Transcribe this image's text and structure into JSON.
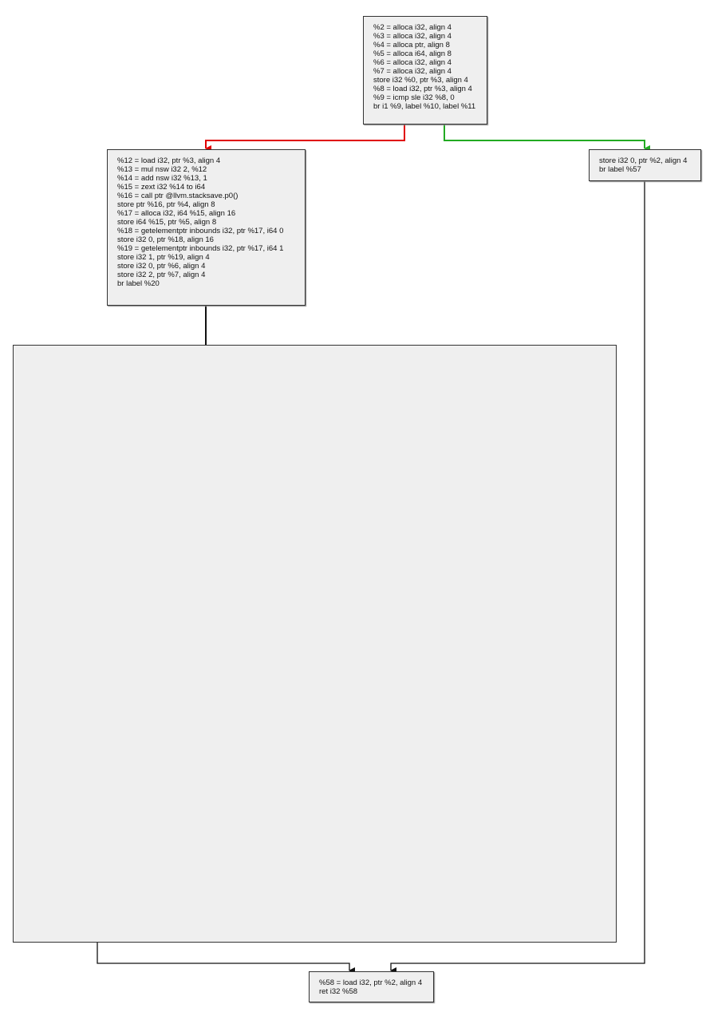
{
  "nodes": {
    "entry": [
      "%2 = alloca i32, align 4",
      "%3 = alloca i32, align 4",
      "%4 = alloca ptr, align 8",
      "%5 = alloca i64, align 8",
      "%6 = alloca i32, align 4",
      "%7 = alloca i32, align 4",
      "store i32 %0, ptr %3, align 4",
      "%8 = load i32, ptr %3, align 4",
      "%9 = icmp sle i32 %8, 0",
      "br i1 %9, label %10, label %11"
    ],
    "block11": [
      "%12 = load i32, ptr %3, align 4",
      "%13 = mul nsw i32 2, %12",
      "%14 = add nsw i32 %13, 1",
      "%15 = zext i32 %14 to i64",
      "%16 = call ptr @llvm.stacksave.p0()",
      "store ptr %16, ptr %4, align 8",
      "%17 = alloca i32, i64 %15, align 16",
      "store i64 %15, ptr %5, align 8",
      "%18 = getelementptr inbounds i32, ptr %17, i64 0",
      "store i32 0, ptr %18, align 16",
      "%19 = getelementptr inbounds i32, ptr %17, i64 1",
      "store i32 1, ptr %19, align 4",
      "store i32 0, ptr %6, align 4",
      "store i32 2, ptr %7, align 4",
      "br label %20"
    ],
    "block10": [
      "store i32 0, ptr %2, align 4",
      "br label %57"
    ],
    "block57": [
      "%58 = load i32, ptr %2, align 4",
      "ret i32 %58"
    ]
  },
  "colors": {
    "true_edge": "#22aa22",
    "false_edge": "#e00000",
    "edge": "#111111",
    "node_fill": "#efefef"
  }
}
